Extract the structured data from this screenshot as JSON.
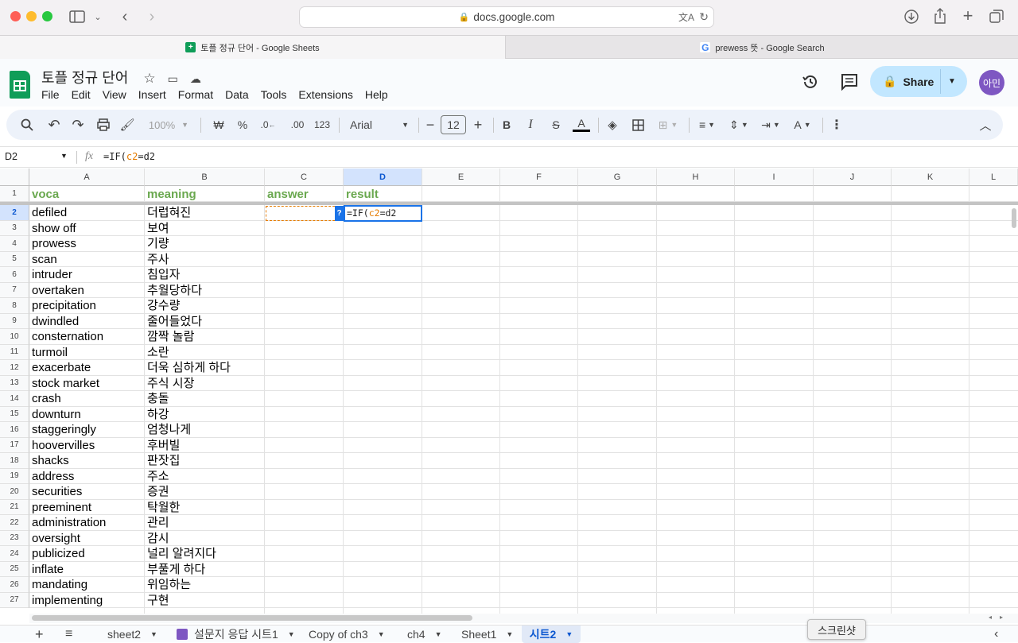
{
  "browser": {
    "url": "docs.google.com",
    "tabs": [
      {
        "title": "토플 정규 단어 - Google Sheets"
      },
      {
        "title": "prewess 뜻 - Google Search"
      }
    ]
  },
  "app": {
    "doc_title": "토플 정규 단어",
    "menus": [
      "File",
      "Edit",
      "View",
      "Insert",
      "Format",
      "Data",
      "Tools",
      "Extensions",
      "Help"
    ],
    "share_label": "Share",
    "avatar_text": "아민"
  },
  "toolbar": {
    "zoom": "100%",
    "currency": "₩",
    "percent": "%",
    "dec_decrease": ".0←",
    "dec_increase": ".00",
    "format_123": "123",
    "font": "Arial",
    "font_size": "12",
    "bold": "B",
    "italic": "I",
    "strike": "S",
    "text_color": "A"
  },
  "formula_bar": {
    "name_box": "D2",
    "fx": "fx",
    "formula_prefix": "=IF(",
    "formula_ref1": "c2",
    "formula_suffix": "=d2"
  },
  "columns": [
    "A",
    "B",
    "C",
    "D",
    "E",
    "F",
    "G",
    "H",
    "I",
    "J",
    "K",
    "L"
  ],
  "headers": {
    "a": "voca",
    "b": "meaning",
    "c": "answer",
    "d": "result"
  },
  "rows": [
    {
      "n": "2",
      "a": "defiled",
      "b": "더럽혀진"
    },
    {
      "n": "3",
      "a": "show off",
      "b": "보여"
    },
    {
      "n": "4",
      "a": "prowess",
      "b": "기량"
    },
    {
      "n": "5",
      "a": "scan",
      "b": "주사"
    },
    {
      "n": "6",
      "a": "intruder",
      "b": "침입자"
    },
    {
      "n": "7",
      "a": "overtaken",
      "b": "추월당하다"
    },
    {
      "n": "8",
      "a": "precipitation",
      "b": "강수량"
    },
    {
      "n": "9",
      "a": "dwindled",
      "b": "줄어들었다"
    },
    {
      "n": "10",
      "a": "consternation",
      "b": "깜짝 놀람"
    },
    {
      "n": "11",
      "a": "turmoil",
      "b": "소란"
    },
    {
      "n": "12",
      "a": "exacerbate",
      "b": "더욱 심하게 하다"
    },
    {
      "n": "13",
      "a": "stock market",
      "b": "주식 시장"
    },
    {
      "n": "14",
      "a": "crash",
      "b": "충돌"
    },
    {
      "n": "15",
      "a": "downturn",
      "b": "하강"
    },
    {
      "n": "16",
      "a": "staggeringly",
      "b": "엄청나게"
    },
    {
      "n": "17",
      "a": "hoovervilles",
      "b": "후버빌"
    },
    {
      "n": "18",
      "a": "shacks",
      "b": "판잣집"
    },
    {
      "n": "19",
      "a": "address",
      "b": "주소"
    },
    {
      "n": "20",
      "a": "securities",
      "b": "증권"
    },
    {
      "n": "21",
      "a": "preeminent",
      "b": "탁월한"
    },
    {
      "n": "22",
      "a": "administration",
      "b": "관리"
    },
    {
      "n": "23",
      "a": "oversight",
      "b": "감시"
    },
    {
      "n": "24",
      "a": "publicized",
      "b": "널리 알려지다"
    },
    {
      "n": "25",
      "a": "inflate",
      "b": "부풀게 하다"
    },
    {
      "n": "26",
      "a": "mandating",
      "b": "위임하는"
    },
    {
      "n": "27",
      "a": "implementing",
      "b": "구현"
    }
  ],
  "active_cell": {
    "prefix": "=IF(",
    "ref": "c2",
    "suffix": "=d2",
    "hint": "?"
  },
  "sheets": [
    "sheet2",
    "설문지 응답 시트1",
    "Copy of ch3",
    "ch4",
    "Sheet1",
    "시트2"
  ],
  "tooltip": "스크린샷",
  "colors": {
    "header_green": "#6aa84f",
    "accent_blue": "#1a73e8",
    "share_bg": "#c2e7ff",
    "ref_orange": "#e67c00"
  }
}
